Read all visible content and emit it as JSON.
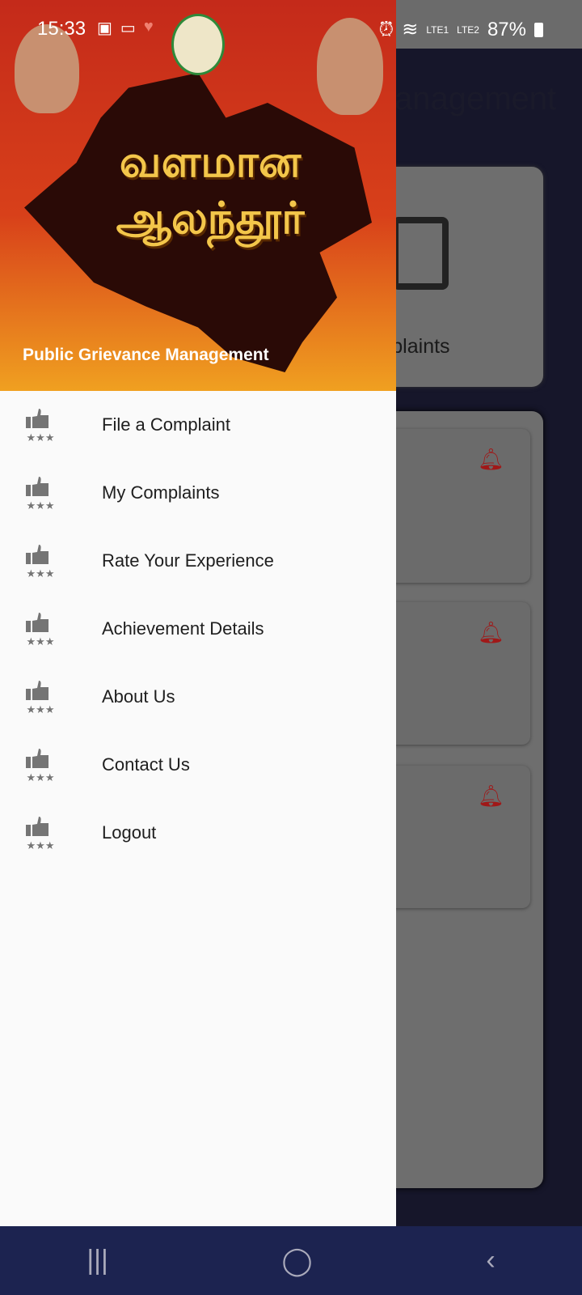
{
  "status_bar": {
    "time": "15:33",
    "sim1": "LTE1",
    "sim2": "LTE2",
    "battery": "87%"
  },
  "background": {
    "title_partial": "anagement",
    "card_label_partial": "mplaints"
  },
  "drawer": {
    "banner": {
      "logo_text_line1": "வளமான",
      "logo_text_line2": "ஆலந்தூர்",
      "caption": "Public Grievance Management"
    },
    "items": [
      {
        "label": "File a Complaint",
        "icon": "thumbs-up-stars-icon"
      },
      {
        "label": "My Complaints",
        "icon": "thumbs-up-stars-icon"
      },
      {
        "label": "Rate Your Experience",
        "icon": "thumbs-up-stars-icon"
      },
      {
        "label": "Achievement Details",
        "icon": "thumbs-up-stars-icon"
      },
      {
        "label": "About Us",
        "icon": "thumbs-up-stars-icon"
      },
      {
        "label": "Contact Us",
        "icon": "thumbs-up-stars-icon"
      },
      {
        "label": "Logout",
        "icon": "thumbs-up-stars-icon"
      }
    ]
  },
  "colors": {
    "banner": "#c42a1a",
    "navbar": "#1c2350",
    "bell": "#a01818",
    "icon": "#757575"
  }
}
